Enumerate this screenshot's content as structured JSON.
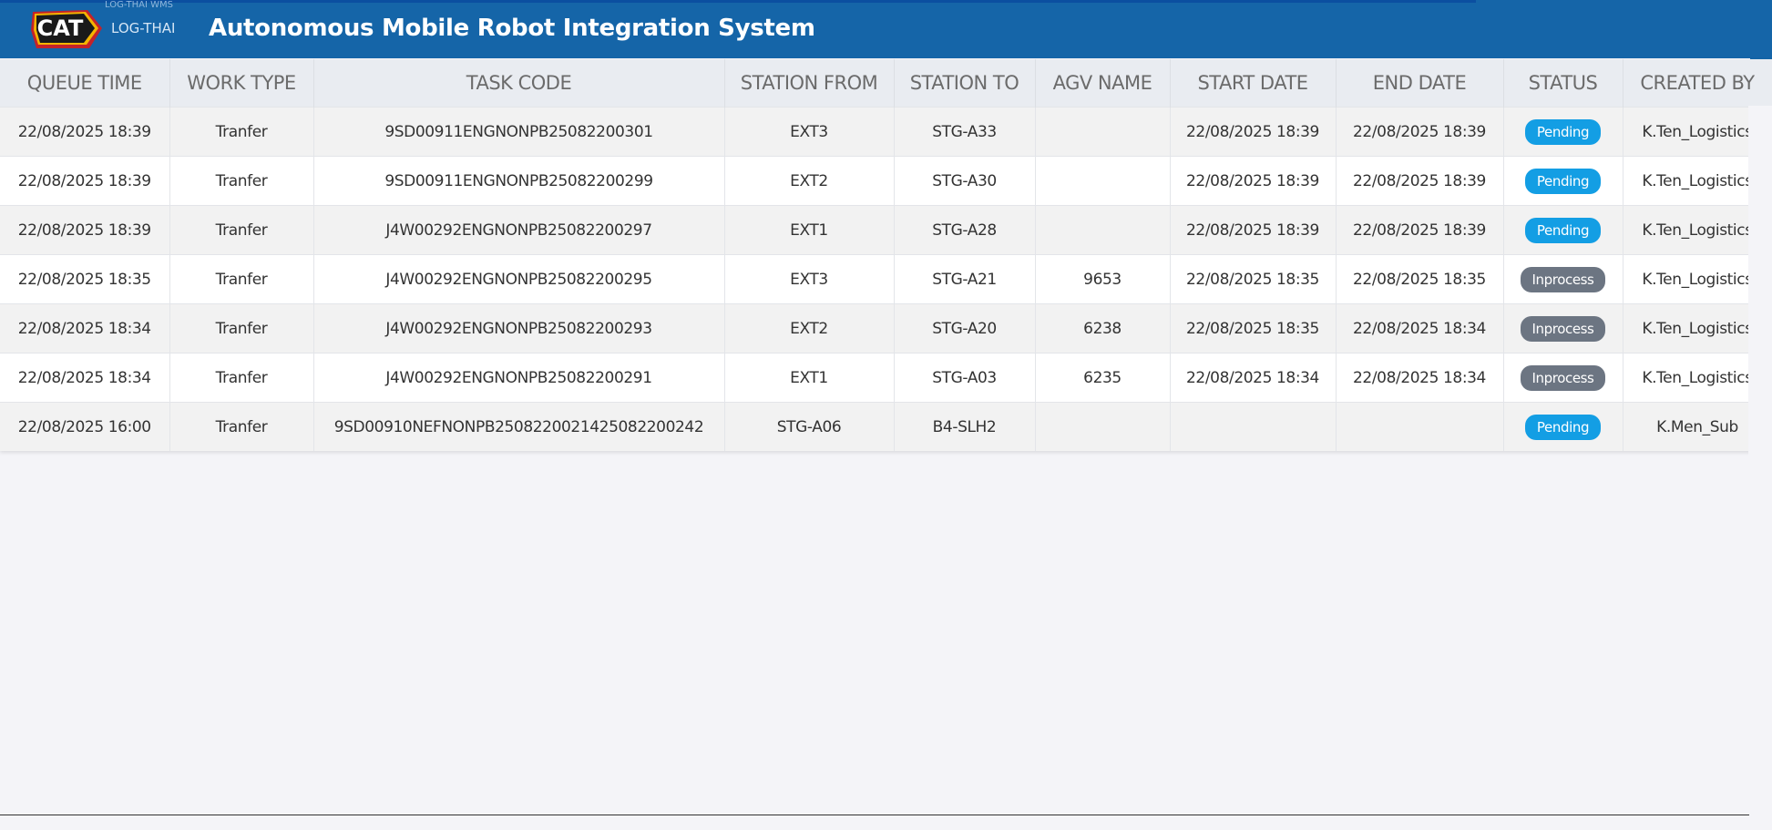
{
  "header": {
    "logo_text": "CAT",
    "logo_sub": "LOG-THAI WMS",
    "brand": "LOG-THAI",
    "title": "Autonomous Mobile Robot Integration System",
    "accent_color": "#1565a8"
  },
  "table": {
    "columns": [
      "QUEUE TIME",
      "WORK TYPE",
      "TASK CODE",
      "STATION FROM",
      "STATION TO",
      "AGV NAME",
      "START DATE",
      "END DATE",
      "STATUS",
      "CREATED BY"
    ],
    "rows": [
      [
        "22/08/2025 18:39",
        "Tranfer",
        "9SD00911ENGNONPB25082200301",
        "EXT3",
        "STG-A33",
        "",
        "22/08/2025 18:39",
        "22/08/2025 18:39",
        "Pending",
        "K.Ten_Logistics"
      ],
      [
        "22/08/2025 18:39",
        "Tranfer",
        "9SD00911ENGNONPB25082200299",
        "EXT2",
        "STG-A30",
        "",
        "22/08/2025 18:39",
        "22/08/2025 18:39",
        "Pending",
        "K.Ten_Logistics"
      ],
      [
        "22/08/2025 18:39",
        "Tranfer",
        "J4W00292ENGNONPB25082200297",
        "EXT1",
        "STG-A28",
        "",
        "22/08/2025 18:39",
        "22/08/2025 18:39",
        "Pending",
        "K.Ten_Logistics"
      ],
      [
        "22/08/2025 18:35",
        "Tranfer",
        "J4W00292ENGNONPB25082200295",
        "EXT3",
        "STG-A21",
        "9653",
        "22/08/2025 18:35",
        "22/08/2025 18:35",
        "Inprocess",
        "K.Ten_Logistics"
      ],
      [
        "22/08/2025 18:34",
        "Tranfer",
        "J4W00292ENGNONPB25082200293",
        "EXT2",
        "STG-A20",
        "6238",
        "22/08/2025 18:35",
        "22/08/2025 18:34",
        "Inprocess",
        "K.Ten_Logistics"
      ],
      [
        "22/08/2025 18:34",
        "Tranfer",
        "J4W00292ENGNONPB25082200291",
        "EXT1",
        "STG-A03",
        "6235",
        "22/08/2025 18:34",
        "22/08/2025 18:34",
        "Inprocess",
        "K.Ten_Logistics"
      ],
      [
        "22/08/2025 16:00",
        "Tranfer",
        "9SD00910NEFNONPB2508220021425082200242",
        "STG-A06",
        "B4-SLH2",
        "",
        "",
        "",
        "Pending",
        "K.Men_Sub"
      ]
    ]
  },
  "status_colors": {
    "Pending": "#139ee4",
    "Inprocess": "#6c7582"
  }
}
